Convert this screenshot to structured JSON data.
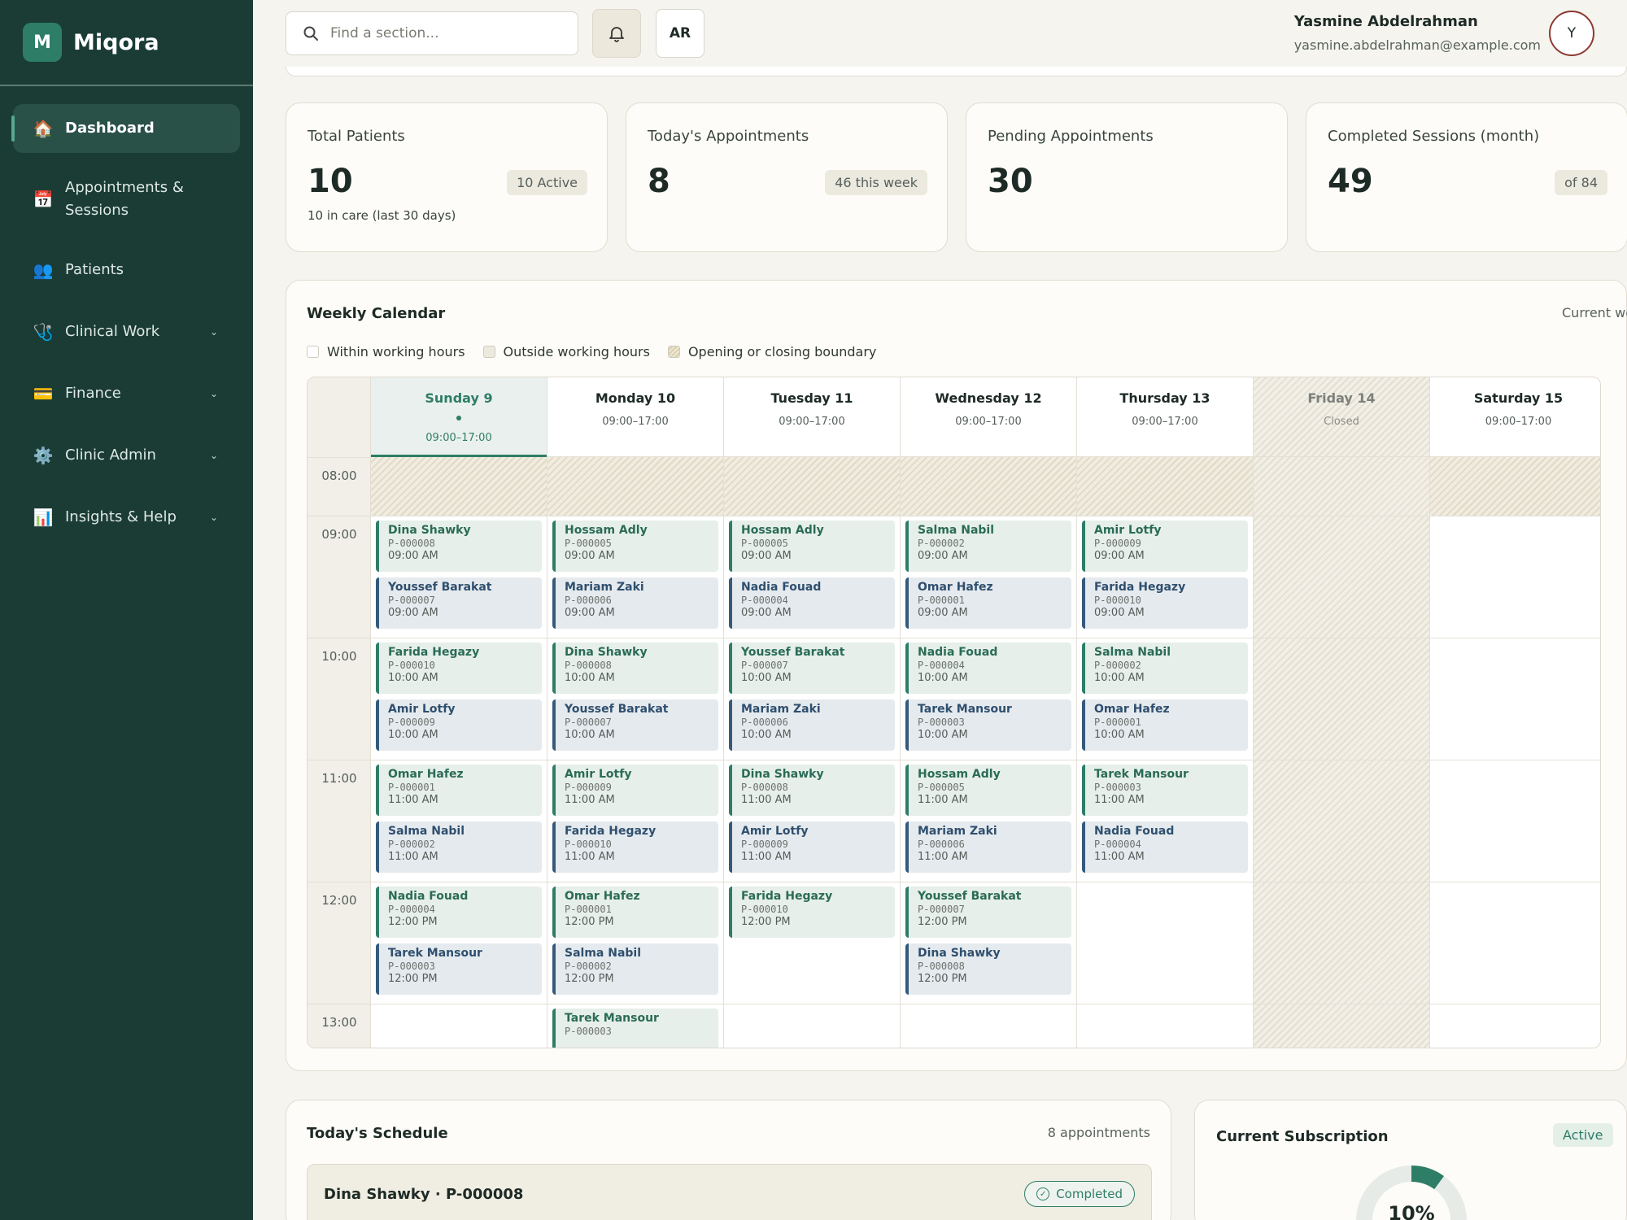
{
  "brand": {
    "initial": "M",
    "name": "Miqora"
  },
  "nav": [
    {
      "label": "Dashboard",
      "icon": "🏠",
      "active": true,
      "chevron": false
    },
    {
      "label": "Appointments & Sessions",
      "icon": "📅",
      "active": false,
      "chevron": false
    },
    {
      "label": "Patients",
      "icon": "👥",
      "active": false,
      "chevron": false
    },
    {
      "label": "Clinical Work",
      "icon": "🩺",
      "active": false,
      "chevron": true
    },
    {
      "label": "Finance",
      "icon": "💳",
      "active": false,
      "chevron": true
    },
    {
      "label": "Clinic Admin",
      "icon": "⚙️",
      "active": false,
      "chevron": true
    },
    {
      "label": "Insights & Help",
      "icon": "📊",
      "active": false,
      "chevron": true
    }
  ],
  "topbar": {
    "search_placeholder": "Find a section...",
    "lang": "AR",
    "user_name": "Yasmine Abdelrahman",
    "user_email": "yasmine.abdelrahman@example.com",
    "avatar": "Y"
  },
  "stats": [
    {
      "title": "Total Patients",
      "value": "10",
      "badge": "10 Active",
      "sub": "10 in care (last 30 days)"
    },
    {
      "title": "Today's Appointments",
      "value": "8",
      "badge": "46 this week",
      "sub": ""
    },
    {
      "title": "Pending Appointments",
      "value": "30",
      "badge": "",
      "sub": ""
    },
    {
      "title": "Completed Sessions (month)",
      "value": "49",
      "badge": "of 84",
      "sub": ""
    }
  ],
  "calendar": {
    "title": "Weekly Calendar",
    "subtitle": "Current week",
    "legend": [
      "Within working hours",
      "Outside working hours",
      "Opening or closing boundary"
    ],
    "times": [
      "08:00",
      "09:00",
      "10:00",
      "11:00",
      "12:00",
      "13:00"
    ],
    "days": [
      {
        "name": "Sunday 9",
        "hours": "09:00–17:00",
        "today": true,
        "closed": false,
        "appts": [
          {
            "slot": 0,
            "sub": 0,
            "name": "Dina Shawky",
            "id": "P-000008",
            "time": "09:00 AM",
            "color": "g"
          },
          {
            "slot": 0,
            "sub": 1,
            "name": "Youssef Barakat",
            "id": "P-000007",
            "time": "09:00 AM",
            "color": "b"
          },
          {
            "slot": 1,
            "sub": 0,
            "name": "Farida Hegazy",
            "id": "P-000010",
            "time": "10:00 AM",
            "color": "g"
          },
          {
            "slot": 1,
            "sub": 1,
            "name": "Amir Lotfy",
            "id": "P-000009",
            "time": "10:00 AM",
            "color": "b"
          },
          {
            "slot": 2,
            "sub": 0,
            "name": "Omar Hafez",
            "id": "P-000001",
            "time": "11:00 AM",
            "color": "g"
          },
          {
            "slot": 2,
            "sub": 1,
            "name": "Salma Nabil",
            "id": "P-000002",
            "time": "11:00 AM",
            "color": "b"
          },
          {
            "slot": 3,
            "sub": 0,
            "name": "Nadia Fouad",
            "id": "P-000004",
            "time": "12:00 PM",
            "color": "g"
          },
          {
            "slot": 3,
            "sub": 1,
            "name": "Tarek Mansour",
            "id": "P-000003",
            "time": "12:00 PM",
            "color": "b"
          }
        ]
      },
      {
        "name": "Monday 10",
        "hours": "09:00–17:00",
        "today": false,
        "closed": false,
        "appts": [
          {
            "slot": 0,
            "sub": 0,
            "name": "Hossam Adly",
            "id": "P-000005",
            "time": "09:00 AM",
            "color": "g"
          },
          {
            "slot": 0,
            "sub": 1,
            "name": "Mariam Zaki",
            "id": "P-000006",
            "time": "09:00 AM",
            "color": "b"
          },
          {
            "slot": 1,
            "sub": 0,
            "name": "Dina Shawky",
            "id": "P-000008",
            "time": "10:00 AM",
            "color": "g"
          },
          {
            "slot": 1,
            "sub": 1,
            "name": "Youssef Barakat",
            "id": "P-000007",
            "time": "10:00 AM",
            "color": "b"
          },
          {
            "slot": 2,
            "sub": 0,
            "name": "Amir Lotfy",
            "id": "P-000009",
            "time": "11:00 AM",
            "color": "g"
          },
          {
            "slot": 2,
            "sub": 1,
            "name": "Farida Hegazy",
            "id": "P-000010",
            "time": "11:00 AM",
            "color": "b"
          },
          {
            "slot": 3,
            "sub": 0,
            "name": "Omar Hafez",
            "id": "P-000001",
            "time": "12:00 PM",
            "color": "g"
          },
          {
            "slot": 3,
            "sub": 1,
            "name": "Salma Nabil",
            "id": "P-000002",
            "time": "12:00 PM",
            "color": "b"
          },
          {
            "slot": 4,
            "sub": 0,
            "name": "Tarek Mansour",
            "id": "P-000003",
            "time": "",
            "color": "g"
          }
        ]
      },
      {
        "name": "Tuesday 11",
        "hours": "09:00–17:00",
        "today": false,
        "closed": false,
        "appts": [
          {
            "slot": 0,
            "sub": 0,
            "name": "Hossam Adly",
            "id": "P-000005",
            "time": "09:00 AM",
            "color": "g"
          },
          {
            "slot": 0,
            "sub": 1,
            "name": "Nadia Fouad",
            "id": "P-000004",
            "time": "09:00 AM",
            "color": "b"
          },
          {
            "slot": 1,
            "sub": 0,
            "name": "Youssef Barakat",
            "id": "P-000007",
            "time": "10:00 AM",
            "color": "g"
          },
          {
            "slot": 1,
            "sub": 1,
            "name": "Mariam Zaki",
            "id": "P-000006",
            "time": "10:00 AM",
            "color": "b"
          },
          {
            "slot": 2,
            "sub": 0,
            "name": "Dina Shawky",
            "id": "P-000008",
            "time": "11:00 AM",
            "color": "g"
          },
          {
            "slot": 2,
            "sub": 1,
            "name": "Amir Lotfy",
            "id": "P-000009",
            "time": "11:00 AM",
            "color": "b"
          },
          {
            "slot": 3,
            "sub": 0,
            "name": "Farida Hegazy",
            "id": "P-000010",
            "time": "12:00 PM",
            "color": "g"
          }
        ]
      },
      {
        "name": "Wednesday 12",
        "hours": "09:00–17:00",
        "today": false,
        "closed": false,
        "appts": [
          {
            "slot": 0,
            "sub": 0,
            "name": "Salma Nabil",
            "id": "P-000002",
            "time": "09:00 AM",
            "color": "g"
          },
          {
            "slot": 0,
            "sub": 1,
            "name": "Omar Hafez",
            "id": "P-000001",
            "time": "09:00 AM",
            "color": "b"
          },
          {
            "slot": 1,
            "sub": 0,
            "name": "Nadia Fouad",
            "id": "P-000004",
            "time": "10:00 AM",
            "color": "g"
          },
          {
            "slot": 1,
            "sub": 1,
            "name": "Tarek Mansour",
            "id": "P-000003",
            "time": "10:00 AM",
            "color": "b"
          },
          {
            "slot": 2,
            "sub": 0,
            "name": "Hossam Adly",
            "id": "P-000005",
            "time": "11:00 AM",
            "color": "g"
          },
          {
            "slot": 2,
            "sub": 1,
            "name": "Mariam Zaki",
            "id": "P-000006",
            "time": "11:00 AM",
            "color": "b"
          },
          {
            "slot": 3,
            "sub": 0,
            "name": "Youssef Barakat",
            "id": "P-000007",
            "time": "12:00 PM",
            "color": "g"
          },
          {
            "slot": 3,
            "sub": 1,
            "name": "Dina Shawky",
            "id": "P-000008",
            "time": "12:00 PM",
            "color": "b"
          }
        ]
      },
      {
        "name": "Thursday 13",
        "hours": "09:00–17:00",
        "today": false,
        "closed": false,
        "appts": [
          {
            "slot": 0,
            "sub": 0,
            "name": "Amir Lotfy",
            "id": "P-000009",
            "time": "09:00 AM",
            "color": "g"
          },
          {
            "slot": 0,
            "sub": 1,
            "name": "Farida Hegazy",
            "id": "P-000010",
            "time": "09:00 AM",
            "color": "b"
          },
          {
            "slot": 1,
            "sub": 0,
            "name": "Salma Nabil",
            "id": "P-000002",
            "time": "10:00 AM",
            "color": "g"
          },
          {
            "slot": 1,
            "sub": 1,
            "name": "Omar Hafez",
            "id": "P-000001",
            "time": "10:00 AM",
            "color": "b"
          },
          {
            "slot": 2,
            "sub": 0,
            "name": "Tarek Mansour",
            "id": "P-000003",
            "time": "11:00 AM",
            "color": "g"
          },
          {
            "slot": 2,
            "sub": 1,
            "name": "Nadia Fouad",
            "id": "P-000004",
            "time": "11:00 AM",
            "color": "b"
          }
        ]
      },
      {
        "name": "Friday 14",
        "hours": "Closed",
        "today": false,
        "closed": true,
        "appts": []
      },
      {
        "name": "Saturday 15",
        "hours": "09:00–17:00",
        "today": false,
        "closed": false,
        "appts": []
      }
    ]
  },
  "schedule": {
    "title": "Today's Schedule",
    "count": "8 appointments",
    "first_name": "Dina Shawky · P-000008",
    "first_status": "Completed"
  },
  "subscription": {
    "title": "Current Subscription",
    "badge": "Active",
    "percent": "10%",
    "fraction": 0.1
  },
  "colors": {
    "sidebar": "#1a3c35",
    "accent": "#2e7d67",
    "appt_green": "#2e7d67",
    "appt_blue": "#355a7a"
  }
}
